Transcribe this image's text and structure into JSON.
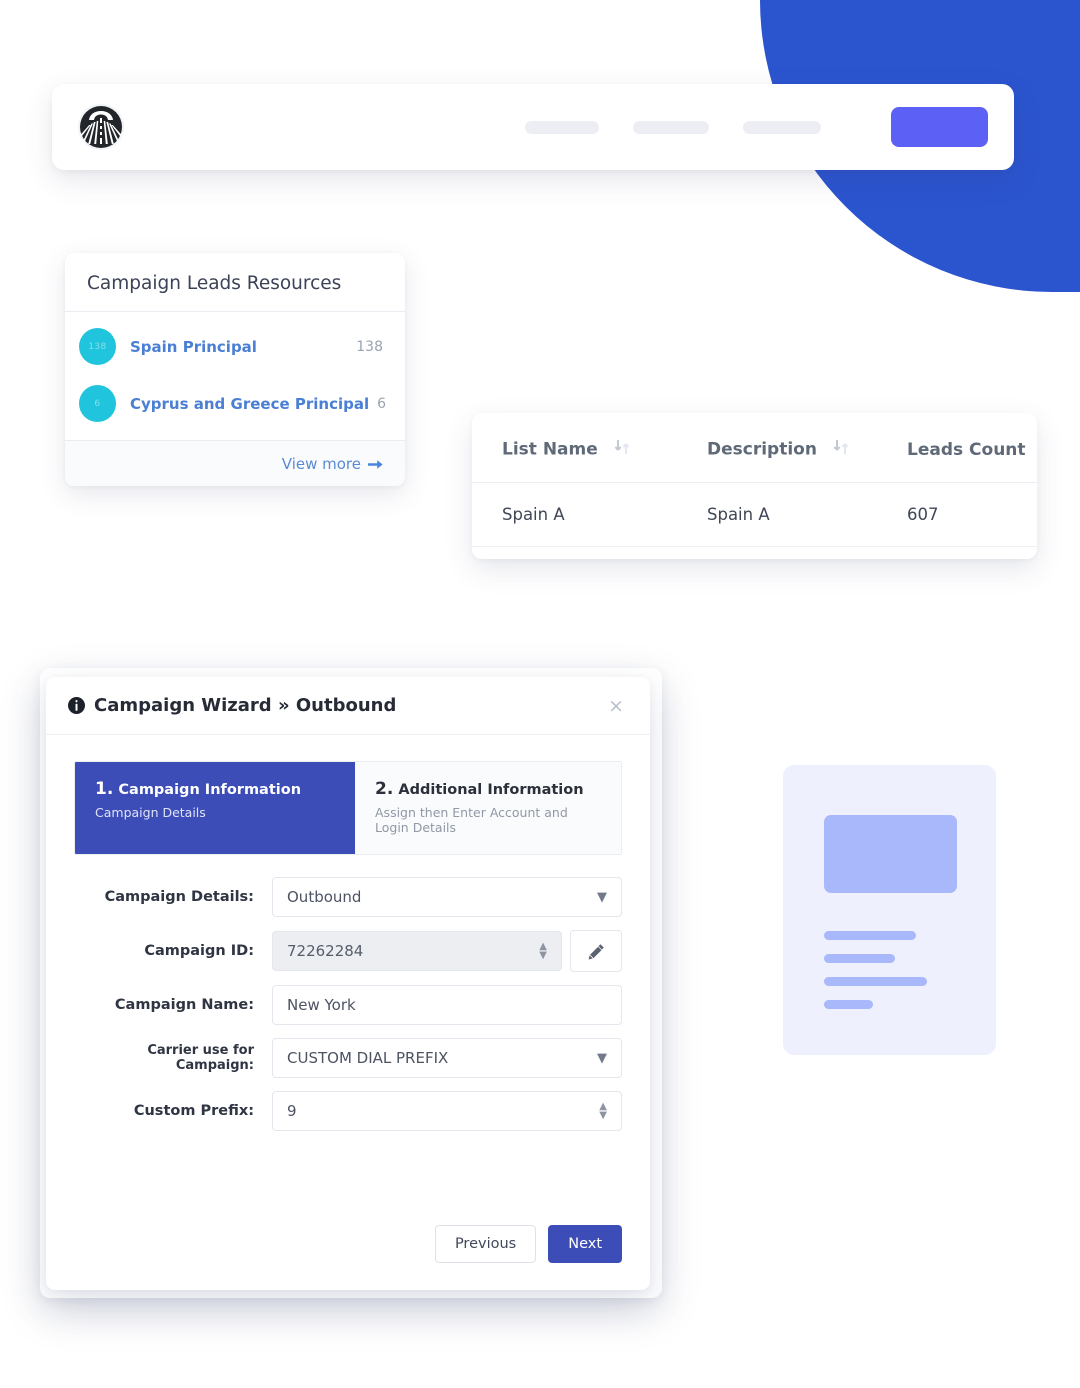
{
  "theme": {
    "blob_blue": "#2b54cf",
    "cta_purple": "#5c60f5",
    "wizard_blue": "#3d4db7",
    "avatar_cyan": "#20c5dd",
    "link_blue": "#4a7fd4",
    "skeleton_bg": "#eef1fd",
    "skeleton_fg": "#a8b8fb"
  },
  "topbar": {
    "logo_name": "company-logo",
    "nav_placeholders": [
      "",
      "",
      ""
    ],
    "cta_label": ""
  },
  "leads_card": {
    "title": "Campaign Leads Resources",
    "rows": [
      {
        "avatar_text": "138",
        "name": "Spain Principal",
        "count": "138"
      },
      {
        "avatar_text": "6",
        "name": "Cyprus and Greece Principal",
        "count": "6"
      }
    ],
    "footer_link": "View more"
  },
  "table_card": {
    "headers": [
      "List Name",
      "Description",
      "Leads Count"
    ],
    "rows": [
      {
        "list_name": "Spain A",
        "description": "Spain A",
        "leads_count": "607"
      }
    ]
  },
  "wizard": {
    "title_icon": "info-icon",
    "title": "Campaign Wizard » Outbound",
    "close_label": "×",
    "steps": [
      {
        "num": "1.",
        "title": "Campaign Information",
        "subtitle": "Campaign Details",
        "active": true
      },
      {
        "num": "2.",
        "title": "Additional Information",
        "subtitle": "Assign then Enter Account and Login Details",
        "active": false
      }
    ],
    "fields": {
      "campaign_details": {
        "label": "Campaign Details:",
        "value": "Outbound"
      },
      "campaign_id": {
        "label": "Campaign ID:",
        "value": "72262284"
      },
      "campaign_name": {
        "label": "Campaign Name:",
        "value": "New York"
      },
      "carrier": {
        "label": "Carrier use for Campaign:",
        "value": "CUSTOM DIAL PREFIX"
      },
      "custom_prefix": {
        "label": "Custom Prefix:",
        "value": "9"
      }
    },
    "buttons": {
      "previous": "Previous",
      "next": "Next"
    }
  }
}
